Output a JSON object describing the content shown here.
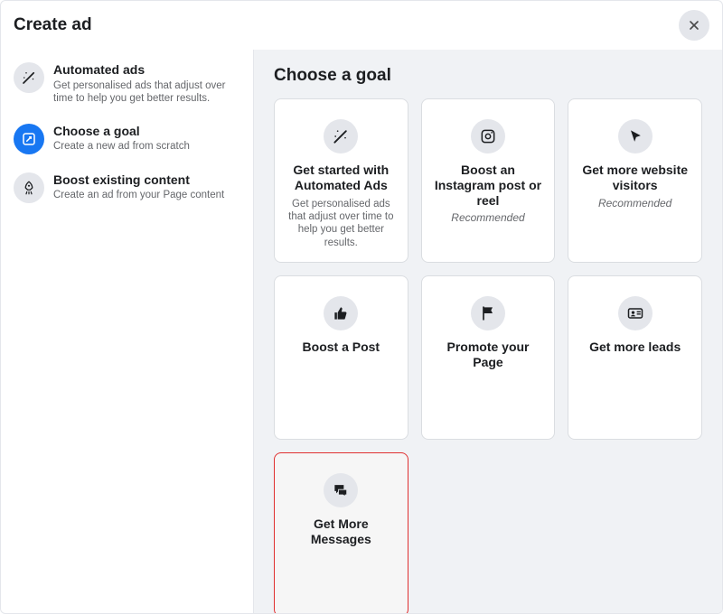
{
  "header": {
    "title": "Create ad"
  },
  "sidebar": {
    "items": [
      {
        "title": "Automated ads",
        "desc": "Get personalised ads that adjust over time to help you get better results."
      },
      {
        "title": "Choose a goal",
        "desc": "Create a new ad from scratch"
      },
      {
        "title": "Boost existing content",
        "desc": "Create an ad from your Page content"
      }
    ]
  },
  "main": {
    "heading": "Choose a goal",
    "cards": [
      {
        "title": "Get started with Automated Ads",
        "desc": "Get personalised ads that adjust over time to help you get better results.",
        "rec": ""
      },
      {
        "title": "Boost an Instagram post or reel",
        "desc": "",
        "rec": "Recommended"
      },
      {
        "title": "Get more website visitors",
        "desc": "",
        "rec": "Recommended"
      },
      {
        "title": "Boost a Post",
        "desc": "",
        "rec": ""
      },
      {
        "title": "Promote your Page",
        "desc": "",
        "rec": ""
      },
      {
        "title": "Get more leads",
        "desc": "",
        "rec": ""
      },
      {
        "title": "Get More Messages",
        "desc": "",
        "rec": ""
      }
    ]
  }
}
